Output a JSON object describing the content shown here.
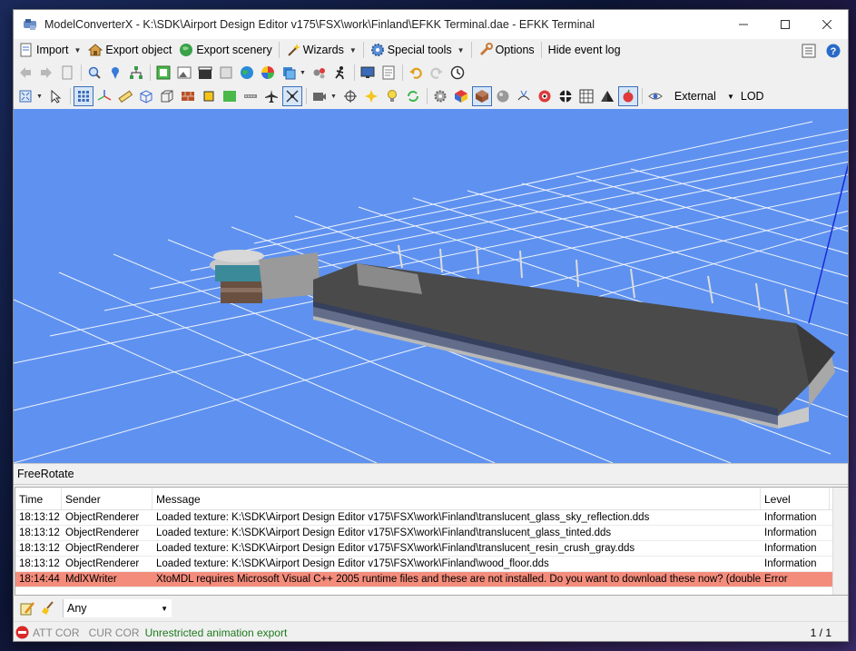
{
  "window": {
    "title": "ModelConverterX - K:\\SDK\\Airport Design Editor v175\\FSX\\work\\Finland\\EFKK Terminal.dae - EFKK Terminal",
    "minimize": "—",
    "maximize": "☐",
    "close": "✕"
  },
  "menu": {
    "import": "Import",
    "export_object": "Export object",
    "export_scenery": "Export scenery",
    "wizards": "Wizards",
    "special_tools": "Special tools",
    "options": "Options",
    "hide_event_log": "Hide event log"
  },
  "toolbar2": {
    "view_mode": "External",
    "lod": "LOD"
  },
  "viewport": {
    "mode": "FreeRotate",
    "background": "#5f92f0"
  },
  "log": {
    "columns": [
      "Time",
      "Sender",
      "Message",
      "Level"
    ],
    "rows": [
      {
        "time": "18:13:12",
        "sender": "ObjectRenderer",
        "message": "Loaded texture: K:\\SDK\\Airport Design Editor v175\\FSX\\work\\Finland\\translucent_glass_sky_reflection.dds",
        "level": "Information"
      },
      {
        "time": "18:13:12",
        "sender": "ObjectRenderer",
        "message": "Loaded texture: K:\\SDK\\Airport Design Editor v175\\FSX\\work\\Finland\\translucent_glass_tinted.dds",
        "level": "Information"
      },
      {
        "time": "18:13:12",
        "sender": "ObjectRenderer",
        "message": "Loaded texture: K:\\SDK\\Airport Design Editor v175\\FSX\\work\\Finland\\translucent_resin_crush_gray.dds",
        "level": "Information"
      },
      {
        "time": "18:13:12",
        "sender": "ObjectRenderer",
        "message": "Loaded texture: K:\\SDK\\Airport Design Editor v175\\FSX\\work\\Finland\\wood_floor.dds",
        "level": "Information"
      },
      {
        "time": "18:14:44",
        "sender": "MdlXWriter",
        "message": "XtoMDL requires Microsoft Visual C++ 2005 runtime files and these are not installed. Do you want to download these now? (double click ...",
        "level": "Error"
      }
    ],
    "error_color": "#f48c7c"
  },
  "filter": {
    "value": "Any"
  },
  "status": {
    "att_cor": "ATT COR",
    "cur_cor": "CUR COR",
    "animation": "Unrestricted animation export",
    "page": "1 / 1"
  }
}
